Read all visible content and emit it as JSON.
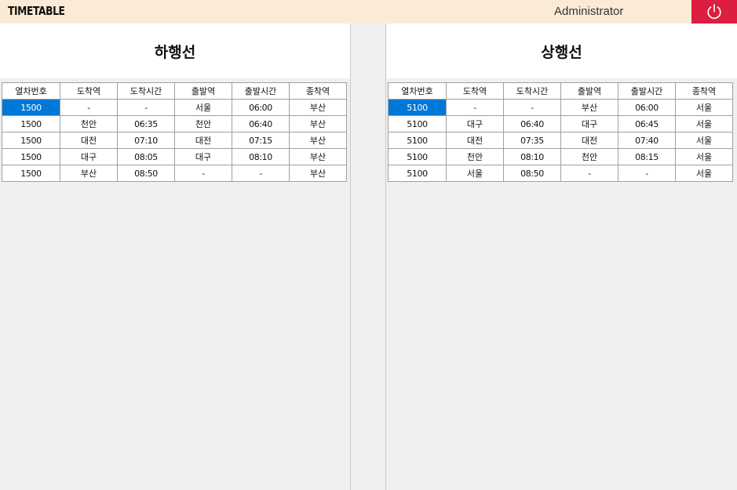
{
  "app": {
    "title": "TIMETABLE",
    "user": "Administrator",
    "power_icon": "power-icon",
    "accent_color": "#dc1f41",
    "topbar_color": "#fbebd6",
    "selection_color": "#0078d7"
  },
  "downline": {
    "title": "하행선",
    "columns": [
      "열차번호",
      "도착역",
      "도착시간",
      "출발역",
      "출발시간",
      "종착역"
    ],
    "rows": [
      [
        "1500",
        "-",
        "-",
        "서울",
        "06:00",
        "부산"
      ],
      [
        "1500",
        "천안",
        "06:35",
        "천안",
        "06:40",
        "부산"
      ],
      [
        "1500",
        "대전",
        "07:10",
        "대전",
        "07:15",
        "부산"
      ],
      [
        "1500",
        "대구",
        "08:05",
        "대구",
        "08:10",
        "부산"
      ],
      [
        "1500",
        "부산",
        "08:50",
        "-",
        "-",
        "부산"
      ]
    ],
    "selected_row": 0
  },
  "upline": {
    "title": "상행선",
    "columns": [
      "열차번호",
      "도착역",
      "도착시간",
      "출발역",
      "출발시간",
      "종착역"
    ],
    "rows": [
      [
        "5100",
        "-",
        "-",
        "부산",
        "06:00",
        "서울"
      ],
      [
        "5100",
        "대구",
        "06:40",
        "대구",
        "06:45",
        "서울"
      ],
      [
        "5100",
        "대전",
        "07:35",
        "대전",
        "07:40",
        "서울"
      ],
      [
        "5100",
        "천안",
        "08:10",
        "천안",
        "08:15",
        "서울"
      ],
      [
        "5100",
        "서울",
        "08:50",
        "-",
        "-",
        "서울"
      ]
    ],
    "selected_row": 0
  }
}
